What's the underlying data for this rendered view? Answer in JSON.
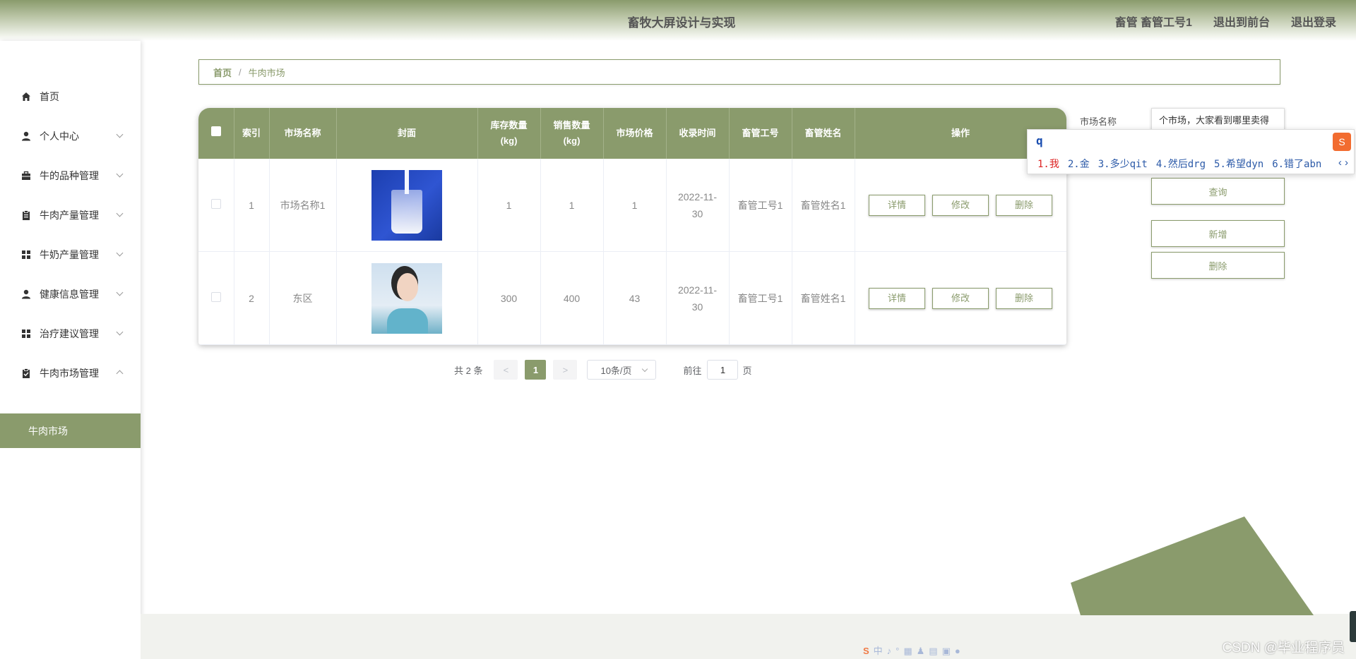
{
  "header": {
    "title": "畜牧大屏设计与实现",
    "user": "畜管 畜管工号1",
    "back_to_front": "退出到前台",
    "logout": "退出登录"
  },
  "sidebar": {
    "items": [
      {
        "label": "首页",
        "icon": "home-icon"
      },
      {
        "label": "个人中心",
        "icon": "user-icon"
      },
      {
        "label": "牛的品种管理",
        "icon": "briefcase-icon"
      },
      {
        "label": "牛肉产量管理",
        "icon": "clipboard-icon"
      },
      {
        "label": "牛奶产量管理",
        "icon": "grid-icon"
      },
      {
        "label": "健康信息管理",
        "icon": "user-icon"
      },
      {
        "label": "治疗建议管理",
        "icon": "grid-icon"
      },
      {
        "label": "牛肉市场管理",
        "icon": "clipboard-check-icon"
      }
    ],
    "active_sub": "牛肉市场"
  },
  "breadcrumb": {
    "home": "首页",
    "separator": "/",
    "current": "牛肉市场"
  },
  "table": {
    "columns": [
      "索引",
      "市场名称",
      "封面",
      "库存数量",
      "(kg)",
      "销售数量",
      "(kg)",
      "市场价格",
      "收录时间",
      "畜管工号",
      "畜管姓名",
      "操作"
    ],
    "rows": [
      {
        "index": "1",
        "name": "市场名称1",
        "cover": "milk-glass-image",
        "stock": "1",
        "sales": "1",
        "price": "1",
        "date1": "2022-11-",
        "date2": "30",
        "staff_id": "畜管工号1",
        "staff_name": "畜管姓名1"
      },
      {
        "index": "2",
        "name": "东区",
        "cover": "woman-portrait-image",
        "stock": "300",
        "sales": "400",
        "price": "43",
        "date1": "2022-11-",
        "date2": "30",
        "staff_id": "畜管工号1",
        "staff_name": "畜管姓名1"
      }
    ],
    "actions": {
      "detail": "详情",
      "edit": "修改",
      "delete": "删除"
    }
  },
  "search": {
    "label": "市场名称",
    "value": "个市场，大家看到哪里卖得",
    "query_button": "查询",
    "add_button": "新增",
    "delete_button": "删除"
  },
  "ime": {
    "typed": "q",
    "candidates": [
      "1.我",
      "2.金",
      "3.多少qit",
      "4.然后drg",
      "5.希望dyn",
      "6.错了abn"
    ],
    "nav": "‹ ›"
  },
  "pagination": {
    "total": "共 2 条",
    "prev": "<",
    "current_page": "1",
    "next": ">",
    "page_size": "10条/页",
    "goto_label": "前往",
    "goto_value": "1",
    "page_suffix": "页"
  },
  "watermark": "CSDN @毕业程序员",
  "colors": {
    "accent": "#8a9b6c",
    "header_text": "#555555"
  }
}
